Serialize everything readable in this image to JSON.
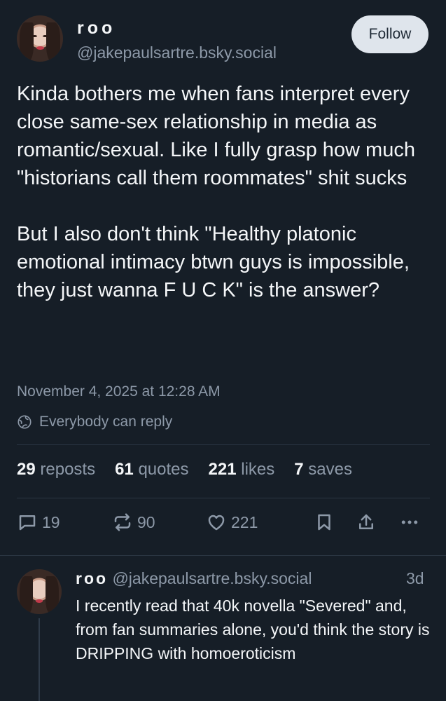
{
  "post": {
    "author": {
      "display_name": "roo",
      "handle": "@jakepaulsartre.bsky.social",
      "follow_label": "Follow"
    },
    "text_paragraph_1": "Kinda bothers me when fans interpret every close same-sex relationship in media as romantic/sexual. Like I fully grasp how much \"historians call them roommates\" shit sucks",
    "text_paragraph_2": "But I also don't think \"Healthy platonic emotional intimacy btwn guys is impossible, they just wanna F U C K\" is the answer?",
    "timestamp": "November 4, 2025 at 12:28 AM",
    "reply_setting": "Everybody can reply",
    "stats": {
      "reposts_count": "29",
      "reposts_label": "reposts",
      "quotes_count": "61",
      "quotes_label": "quotes",
      "likes_count": "221",
      "likes_label": "likes",
      "saves_count": "7",
      "saves_label": "saves"
    },
    "actions": {
      "reply_count": "19",
      "repost_count": "90",
      "like_count": "221"
    }
  },
  "reply": {
    "display_name": "roo",
    "handle": "@jakepaulsartre.bsky.social",
    "age": "3d",
    "text": "I recently read that 40k novella \"Severed\" and, from fan summaries alone, you'd think the story is DRIPPING with homoeroticism"
  },
  "colors": {
    "background": "#161e27",
    "muted_text": "#8d99a8",
    "follow_button_bg": "#dfe5ec"
  }
}
